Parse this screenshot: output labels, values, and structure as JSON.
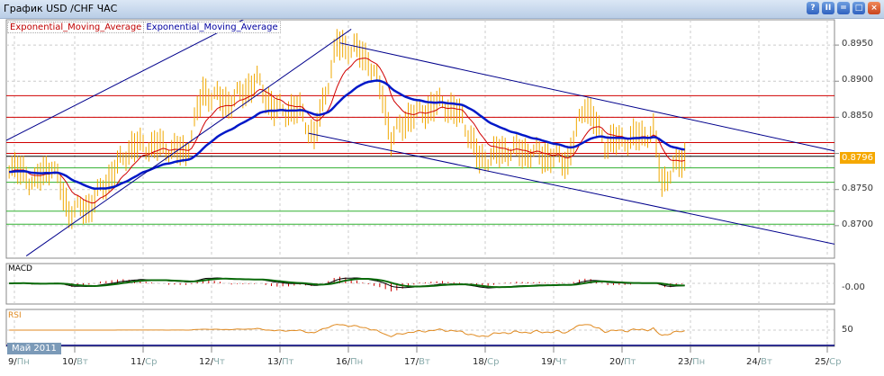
{
  "window": {
    "title": "График USD /CHF  ЧАС",
    "buttons": [
      "help",
      "pause",
      "restore",
      "maximize",
      "close"
    ]
  },
  "legend": [
    {
      "label": "Exponential_Moving_Average",
      "color": "#c00000"
    },
    {
      "label": "Exponential_Moving_Average",
      "color": "#0000a0"
    }
  ],
  "month_label": "Май 2011",
  "colors": {
    "price": "#f0a800",
    "ema_fast": "#d00000",
    "ema_slow": "#0018c8",
    "trend": "#00008c",
    "res": "#d00000",
    "sup": "#30b030",
    "current": "#000000",
    "macd": "#0a6a0a",
    "rsi": "#e08a20"
  },
  "chart_data": {
    "type": "line",
    "y_ticks": [
      "0.8950",
      "0.8900",
      "0.8850",
      "0.8800",
      "0.8750",
      "0.8700"
    ],
    "ylim": [
      0.8655,
      0.8985
    ],
    "trading_days": [
      "2011-05-09",
      "2011-05-10",
      "2011-05-11",
      "2011-05-12",
      "2011-05-13",
      "2011-05-16",
      "2011-05-17",
      "2011-05-18",
      "2011-05-19",
      "2011-05-20",
      "2011-05-23",
      "2011-05-24",
      "2011-05-25"
    ],
    "x_ticks": [
      {
        "day": "9",
        "dow": "Пн"
      },
      {
        "day": "10",
        "dow": "Вт"
      },
      {
        "day": "11",
        "dow": "Ср"
      },
      {
        "day": "12",
        "dow": "Чт"
      },
      {
        "day": "13",
        "dow": "Пт"
      },
      {
        "day": "16",
        "dow": "Пн"
      },
      {
        "day": "17",
        "dow": "Вт"
      },
      {
        "day": "18",
        "dow": "Ср"
      },
      {
        "day": "19",
        "dow": "Чт"
      },
      {
        "day": "20",
        "dow": "Пт"
      },
      {
        "day": "23",
        "dow": "Пн"
      },
      {
        "day": "24",
        "dow": "Вт"
      },
      {
        "day": "25",
        "dow": "Ср"
      }
    ],
    "price": [
      [
        "2011-05-09 01",
        0.8785
      ],
      [
        "2011-05-09 10",
        0.876
      ],
      [
        "2011-05-09 16",
        0.8785
      ],
      [
        "2011-05-09 22",
        0.872
      ],
      [
        "2011-05-10 05",
        0.8725
      ],
      [
        "2011-05-10 11",
        0.876
      ],
      [
        "2011-05-10 20",
        0.881
      ],
      [
        "2011-05-11 06",
        0.881
      ],
      [
        "2011-05-11 15",
        0.88
      ],
      [
        "2011-05-11 21",
        0.8885
      ],
      [
        "2011-05-12 06",
        0.887
      ],
      [
        "2011-05-12 16",
        0.89
      ],
      [
        "2011-05-12 22",
        0.886
      ],
      [
        "2011-05-13 07",
        0.886
      ],
      [
        "2011-05-13 12",
        0.882
      ],
      [
        "2011-05-13 20",
        0.895
      ],
      [
        "2011-05-16 02",
        0.8945
      ],
      [
        "2011-05-16 07",
        0.893
      ],
      [
        "2011-05-16 12",
        0.888
      ],
      [
        "2011-05-16 15",
        0.882
      ],
      [
        "2011-05-16 21",
        0.885
      ],
      [
        "2011-05-17 09",
        0.887
      ],
      [
        "2011-05-17 16",
        0.885
      ],
      [
        "2011-05-17 22",
        0.879
      ],
      [
        "2011-05-18 07",
        0.8805
      ],
      [
        "2011-05-18 17",
        0.88
      ],
      [
        "2011-05-19 05",
        0.879
      ],
      [
        "2011-05-19 11",
        0.887
      ],
      [
        "2011-05-19 18",
        0.8815
      ],
      [
        "2011-05-20 03",
        0.882
      ],
      [
        "2011-05-20 11",
        0.883
      ],
      [
        "2011-05-20 14",
        0.876
      ],
      [
        "2011-05-20 22",
        0.8796
      ]
    ],
    "current_price": "0.8796",
    "resistance_levels": [
      0.888,
      0.885,
      0.8815,
      0.88
    ],
    "support_levels": [
      0.878,
      0.876,
      0.872,
      0.8702
    ],
    "trend_lines": [
      [
        [
          "2011-05-09 00",
          0.8818
        ],
        [
          "2011-05-13 06",
          0.9023
        ]
      ],
      [
        [
          "2011-05-09 07",
          0.8658
        ],
        [
          "2011-05-16 01",
          0.8972
        ]
      ],
      [
        [
          "2011-05-13 21",
          0.8953
        ],
        [
          "2011-05-25 03",
          0.8803
        ]
      ],
      [
        [
          "2011-05-13 10",
          0.8828
        ],
        [
          "2011-05-25 03",
          0.8674
        ]
      ]
    ],
    "macd": {
      "label": "MACD",
      "tick": "-0.00"
    },
    "rsi": {
      "label": "RSI",
      "tick": "50"
    }
  }
}
